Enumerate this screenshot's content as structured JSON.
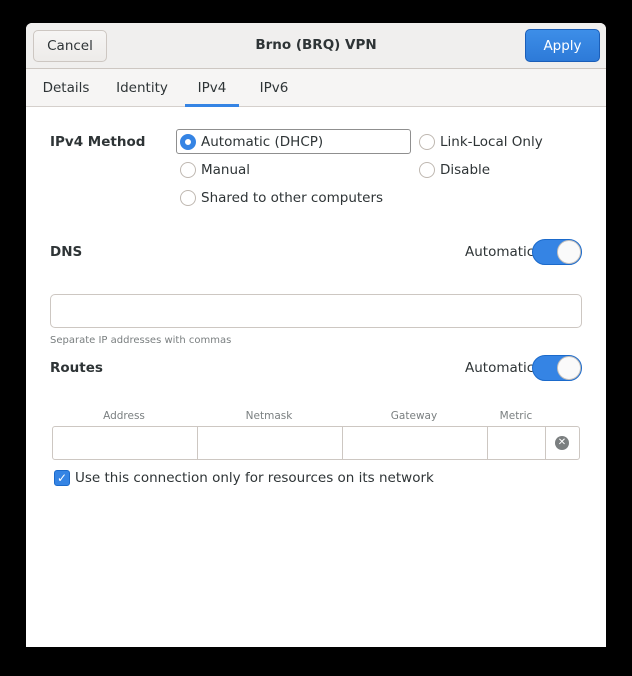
{
  "header": {
    "cancel_label": "Cancel",
    "title": "Brno (BRQ) VPN",
    "apply_label": "Apply"
  },
  "tabs": [
    {
      "label": "Details",
      "active": false
    },
    {
      "label": "Identity",
      "active": false
    },
    {
      "label": "IPv4",
      "active": true
    },
    {
      "label": "IPv6",
      "active": false
    }
  ],
  "ipv4_method": {
    "label": "IPv4 Method",
    "options": [
      {
        "label": "Automatic (DHCP)",
        "checked": true
      },
      {
        "label": "Link-Local Only",
        "checked": false
      },
      {
        "label": "Manual",
        "checked": false
      },
      {
        "label": "Disable",
        "checked": false
      },
      {
        "label": "Shared to other computers",
        "checked": false
      }
    ]
  },
  "dns": {
    "label": "DNS",
    "automatic_label": "Automatic",
    "automatic_on": true,
    "value": "",
    "hint": "Separate IP addresses with commas"
  },
  "routes": {
    "label": "Routes",
    "automatic_label": "Automatic",
    "automatic_on": true,
    "columns": [
      "Address",
      "Netmask",
      "Gateway",
      "Metric"
    ]
  },
  "only_local": {
    "label": "Use this connection only for resources on its network",
    "checked": true
  },
  "colors": {
    "accent": "#3584e4",
    "headerbar": "#f0efee"
  }
}
